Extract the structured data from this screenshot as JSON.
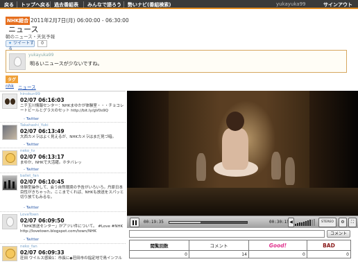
{
  "topnav": {
    "items": [
      "戻る",
      "トップへ戻る",
      "過去番組表",
      "みんなで語ろう",
      "勢いナビ(番組検索)"
    ],
    "user_name": "yukayuka99",
    "signout": "サインアウト"
  },
  "program": {
    "channel_badge": "NHK総合",
    "datetime": "2011年2月7日(月) 06:00:00 - 06:30:00",
    "title": "ニュース",
    "subtitle": "朝のニュース・天気予報",
    "tweet_button": "ツイートする",
    "tweet_count": "0"
  },
  "top_comment": {
    "user": "yukayuka99",
    "text": "明るいニュースが少ないですね。"
  },
  "tags": {
    "label": "タグ",
    "items": [
      "nhk",
      "ニュース"
    ]
  },
  "timeline": [
    {
      "user": "hinokun99",
      "time": "02/07 06:16:03",
      "text": "ニチ玉川情報センター：NHKまゆかが体験室・・・チョコレートビールとグラスのセット http://bit.ly/gV0s9Q",
      "source": "- Twitter"
    },
    {
      "user": "Takahashi_Yuki",
      "time": "02/07 06:13:49",
      "text": "大西カメラはよく見えるが、NHKカメラはまだ見づ暗。",
      "source": "- Twitter"
    },
    {
      "user": "neko_tv",
      "time": "02/07 06:13:17",
      "text": "まゆか、NHKで大活躍。ホタバレッ",
      "source": "- Twitter"
    },
    {
      "user": "ballet_fan",
      "time": "02/07 06:10:45",
      "text": "体験型操作して、会う自然環境の予告がいろいろ。丹原日本目性がきちゃった。ここまでくれば、NHKも放送をスパッと切り放てもみるな。",
      "source": "- Twitter"
    },
    {
      "user": "LoveTown",
      "time": "02/07 06:09:50",
      "text": "「NHK放送センター」がアツい件について。 #Love #NHK http://lovetown.blogspot.com/town/NHK",
      "source": "- Twitter"
    },
    {
      "user": "neko_fan",
      "time": "02/07 06:09:33",
      "text": "荘田 ウイルス感染1：市長に◆荘田市の指定地で鳥インフル",
      "source": ""
    }
  ],
  "player": {
    "current_time": "00:19:35",
    "total_time": "00:30:15",
    "progress": 0.4,
    "volume": 0.8,
    "stereo_label": "STEREO"
  },
  "comment_form": {
    "placeholder": "",
    "submit_label": "コメント"
  },
  "stats": {
    "headers": [
      "閲覧回数",
      "コメント",
      "Good!",
      "BAD"
    ],
    "values": [
      "0",
      "14",
      "0",
      "0"
    ]
  }
}
